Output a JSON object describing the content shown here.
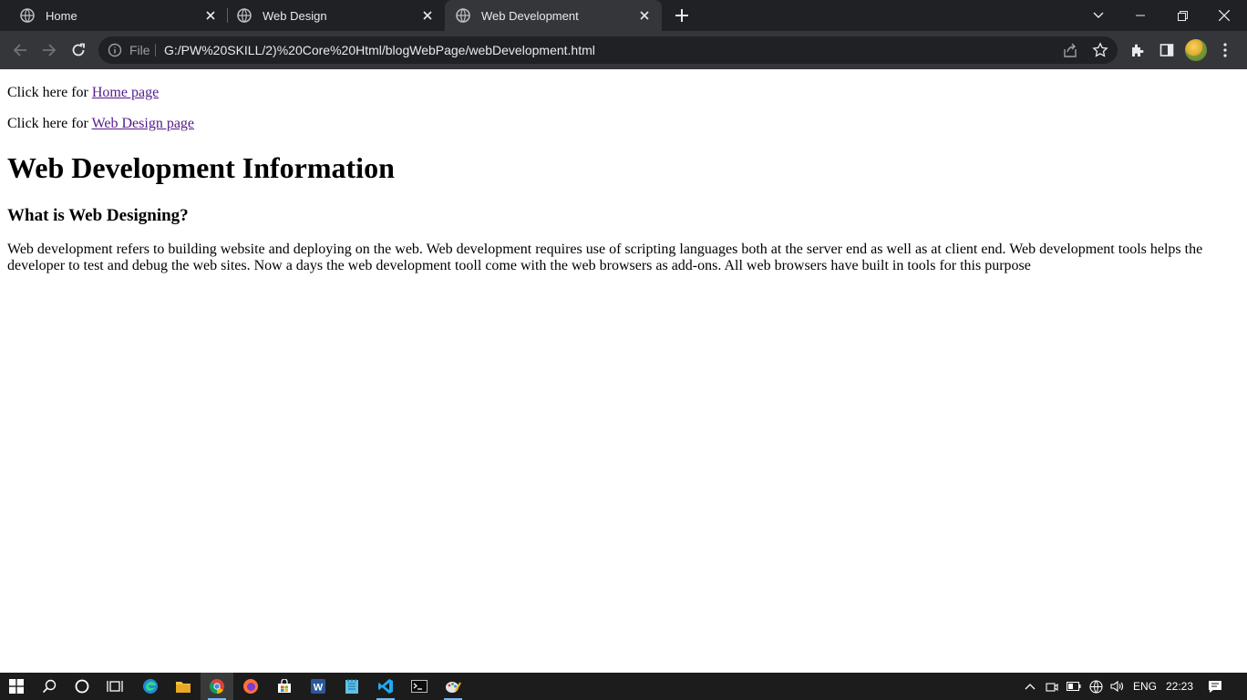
{
  "browser": {
    "tabs": [
      {
        "title": "Home",
        "active": false
      },
      {
        "title": "Web Design",
        "active": false
      },
      {
        "title": "Web Development",
        "active": true
      }
    ],
    "address": {
      "scheme_label": "File",
      "url": "G:/PW%20SKILL/2)%20Core%20Html/blogWebPage/webDevelopment.html"
    }
  },
  "page": {
    "home_prefix": "Click here for ",
    "home_link": "Home page",
    "design_prefix": "Click here for ",
    "design_link": "Web Design page",
    "heading": "Web Development Information",
    "subheading": "What is Web Designing?",
    "paragraph": "Web development refers to building website and deploying on the web. Web development requires use of scripting languages both at the server end as well as at client end. Web development tools helps the developer to test and debug the web sites. Now a days the web development tooll come with the web browsers as add-ons. All web browsers have built in tools for this purpose"
  },
  "taskbar": {
    "language": "ENG",
    "time": "22:23",
    "apps": [
      "start-icon",
      "search-icon",
      "cortana-icon",
      "task-view-icon",
      "edge-icon",
      "file-explorer-icon",
      "chrome-icon",
      "firefox-icon",
      "store-icon",
      "word-icon",
      "notepad-icon",
      "vscode-icon",
      "terminal-icon",
      "paint-icon"
    ]
  },
  "colors": {
    "link": "#551a8b",
    "tab_bar": "#202124",
    "toolbar": "#35363a"
  }
}
